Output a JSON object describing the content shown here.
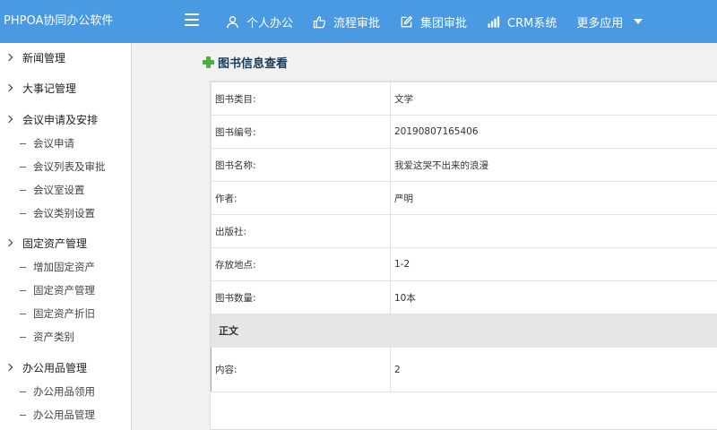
{
  "app": {
    "title": "PHPOA协同办公软件"
  },
  "nav": {
    "items": [
      {
        "label": "个人办公",
        "icon": "user-icon"
      },
      {
        "label": "流程审批",
        "icon": "thumbs-up-icon"
      },
      {
        "label": "集团审批",
        "icon": "edit-icon"
      },
      {
        "label": "CRM系统",
        "icon": "bar-chart-icon"
      }
    ],
    "more_label": "更多应用"
  },
  "sidebar": {
    "groups": [
      {
        "label": "新闻管理",
        "items": []
      },
      {
        "label": "大事记管理",
        "items": []
      },
      {
        "label": "会议申请及安排",
        "items": [
          "会议申请",
          "会议列表及审批",
          "会议室设置",
          "会议类别设置"
        ]
      },
      {
        "label": "固定资产管理",
        "items": [
          "增加固定资产",
          "固定资产管理",
          "固定资产折旧",
          "资产类别"
        ]
      },
      {
        "label": "办公用品管理",
        "items": [
          "办公用品领用",
          "办公用品管理"
        ]
      }
    ]
  },
  "page": {
    "title": "图书信息查看",
    "rows": [
      {
        "label": "图书类目:",
        "value": "文学"
      },
      {
        "label": "图书编号:",
        "value": "2019080716540​6"
      },
      {
        "label": "图书名称:",
        "value": "我爱这哭不出来的浪漫"
      },
      {
        "label": "作者:",
        "value": "严明"
      },
      {
        "label": "出版社:",
        "value": ""
      },
      {
        "label": "存放地点:",
        "value": "1-2"
      },
      {
        "label": "图书数量:",
        "value": "10本"
      }
    ],
    "section_title": "正文",
    "content_label": "内容:",
    "content_value": "2"
  }
}
